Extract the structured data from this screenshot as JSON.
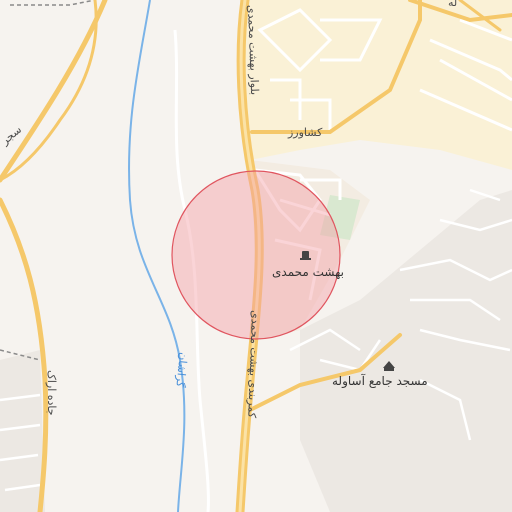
{
  "map": {
    "labels": {
      "highway_north": "بلوار بهشت محمدی",
      "highway_south": "کمربندی بهشت محمدی",
      "street_keshavarz": "کشاورز",
      "river": "گراشان",
      "road_left": "سجر",
      "road_left_lower": "جاده اراک",
      "poi_center": "بهشت محمدی",
      "poi_mosque": "مسجد جامع آساوله",
      "top_corner": "له"
    },
    "colors": {
      "background": "#f6f3ef",
      "road_major": "#f5c86a",
      "road_minor": "#ffffff",
      "urban": "#faf1d6",
      "water": "#7ab3e8",
      "circle_fill": "#f4a0a6",
      "circle_stroke": "#e0555f",
      "park": "#d9e8d0"
    },
    "icons": [
      "cemetery-icon",
      "mosque-icon"
    ]
  }
}
